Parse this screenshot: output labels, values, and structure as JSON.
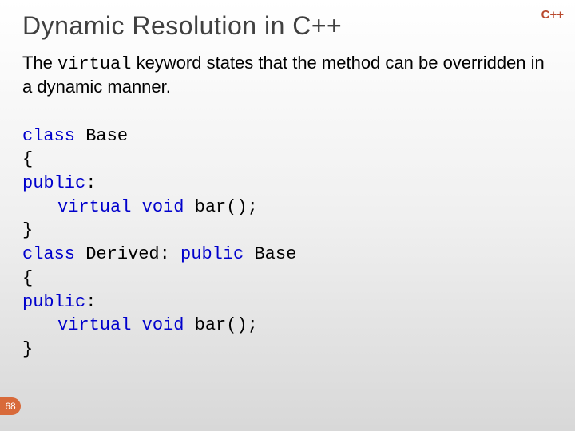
{
  "corner": "C++",
  "title": "Dynamic Resolution in C++",
  "intro": {
    "pre": "The ",
    "kw": "virtual",
    "post": " keyword states that the method can be overridden in a dynamic manner."
  },
  "code": {
    "l1_kw": "class",
    "l1_rest": " Base",
    "l2": "{",
    "l3_kw": "public",
    "l3_post": ":",
    "l4_kw1": "virtual",
    "l4_sp1": " ",
    "l4_kw2": "void",
    "l4_rest": " bar();",
    "l5": "}",
    "l6_kw1": "class",
    "l6_mid": " Derived: ",
    "l6_kw2": "public",
    "l6_rest": " Base",
    "l7": "{",
    "l8_kw": "public",
    "l8_post": ":",
    "l9_kw1": "virtual",
    "l9_sp1": " ",
    "l9_kw2": "void",
    "l9_rest": " bar();",
    "l10": "}"
  },
  "page": "68"
}
